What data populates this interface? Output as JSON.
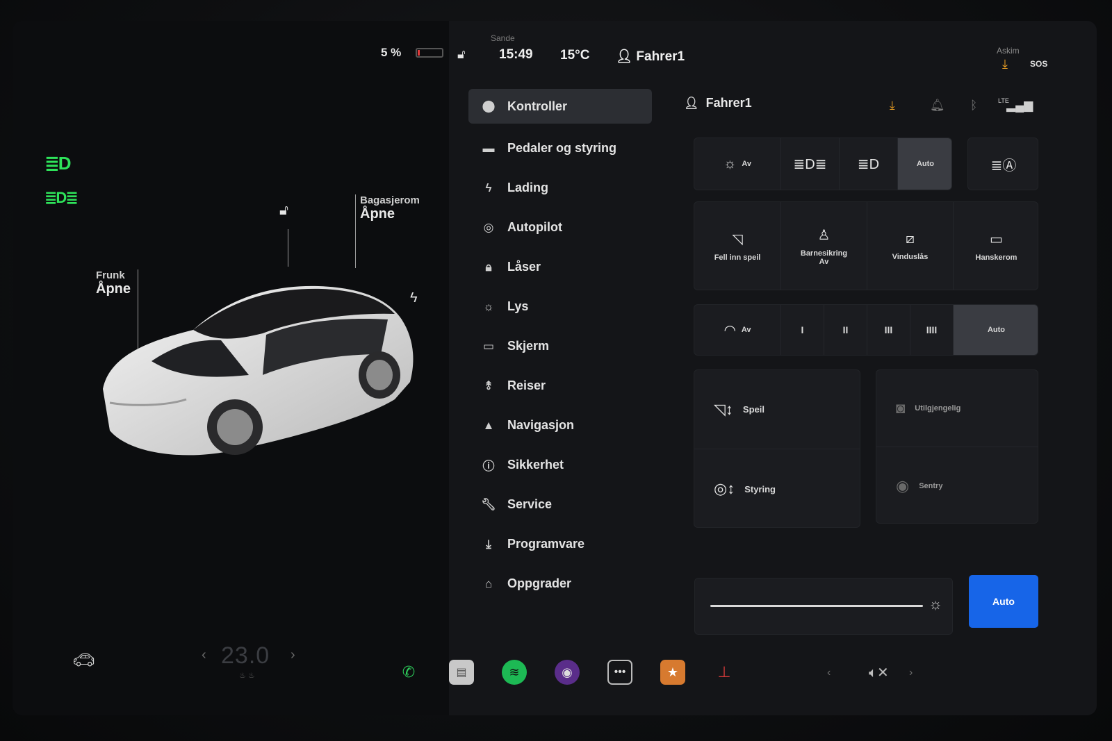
{
  "status": {
    "battery_percent": "5 %",
    "battery_level": 0.05,
    "time": "15:49",
    "temperature": "15°C",
    "user": "Fahrer1",
    "map_label_top": "Sande",
    "map_label_right": "Askim",
    "sos_label": "SOS"
  },
  "car": {
    "frunk_title": "Frunk",
    "frunk_state": "Åpne",
    "trunk_title": "Bagasjerom",
    "trunk_state": "Åpne"
  },
  "menu": {
    "items": [
      {
        "label": "Kontroller",
        "icon": "toggle-icon"
      },
      {
        "label": "Pedaler og styring",
        "icon": "car-icon"
      },
      {
        "label": "Lading",
        "icon": "bolt-icon"
      },
      {
        "label": "Autopilot",
        "icon": "steering-wheel-icon"
      },
      {
        "label": "Låser",
        "icon": "lock-icon"
      },
      {
        "label": "Lys",
        "icon": "sun-icon"
      },
      {
        "label": "Skjerm",
        "icon": "display-icon"
      },
      {
        "label": "Reiser",
        "icon": "route-icon"
      },
      {
        "label": "Navigasjon",
        "icon": "navigation-arrow-icon"
      },
      {
        "label": "Sikkerhet",
        "icon": "alert-circle-icon"
      },
      {
        "label": "Service",
        "icon": "wrench-icon"
      },
      {
        "label": "Programvare",
        "icon": "download-icon"
      },
      {
        "label": "Oppgrader",
        "icon": "bag-icon"
      }
    ]
  },
  "controls": {
    "driver": "Fahrer1",
    "lte_label": "LTE",
    "lights": {
      "off": "Av",
      "auto": "Auto"
    },
    "quick": [
      {
        "label": "Fell inn speil",
        "sub": ""
      },
      {
        "label": "Barnesikring",
        "sub": "Av"
      },
      {
        "label": "Vinduslås",
        "sub": ""
      },
      {
        "label": "Hanskerom",
        "sub": ""
      }
    ],
    "wipers": {
      "off": "Av",
      "s1": "I",
      "s2": "II",
      "s3": "III",
      "s4": "IIII",
      "auto": "Auto"
    },
    "mirrors": "Speil",
    "steering": "Styring",
    "unavailable": "Utilgjengelig",
    "sentry": "Sentry",
    "brightness_auto": "Auto"
  },
  "bottom": {
    "cabin_temp": "23.0"
  }
}
